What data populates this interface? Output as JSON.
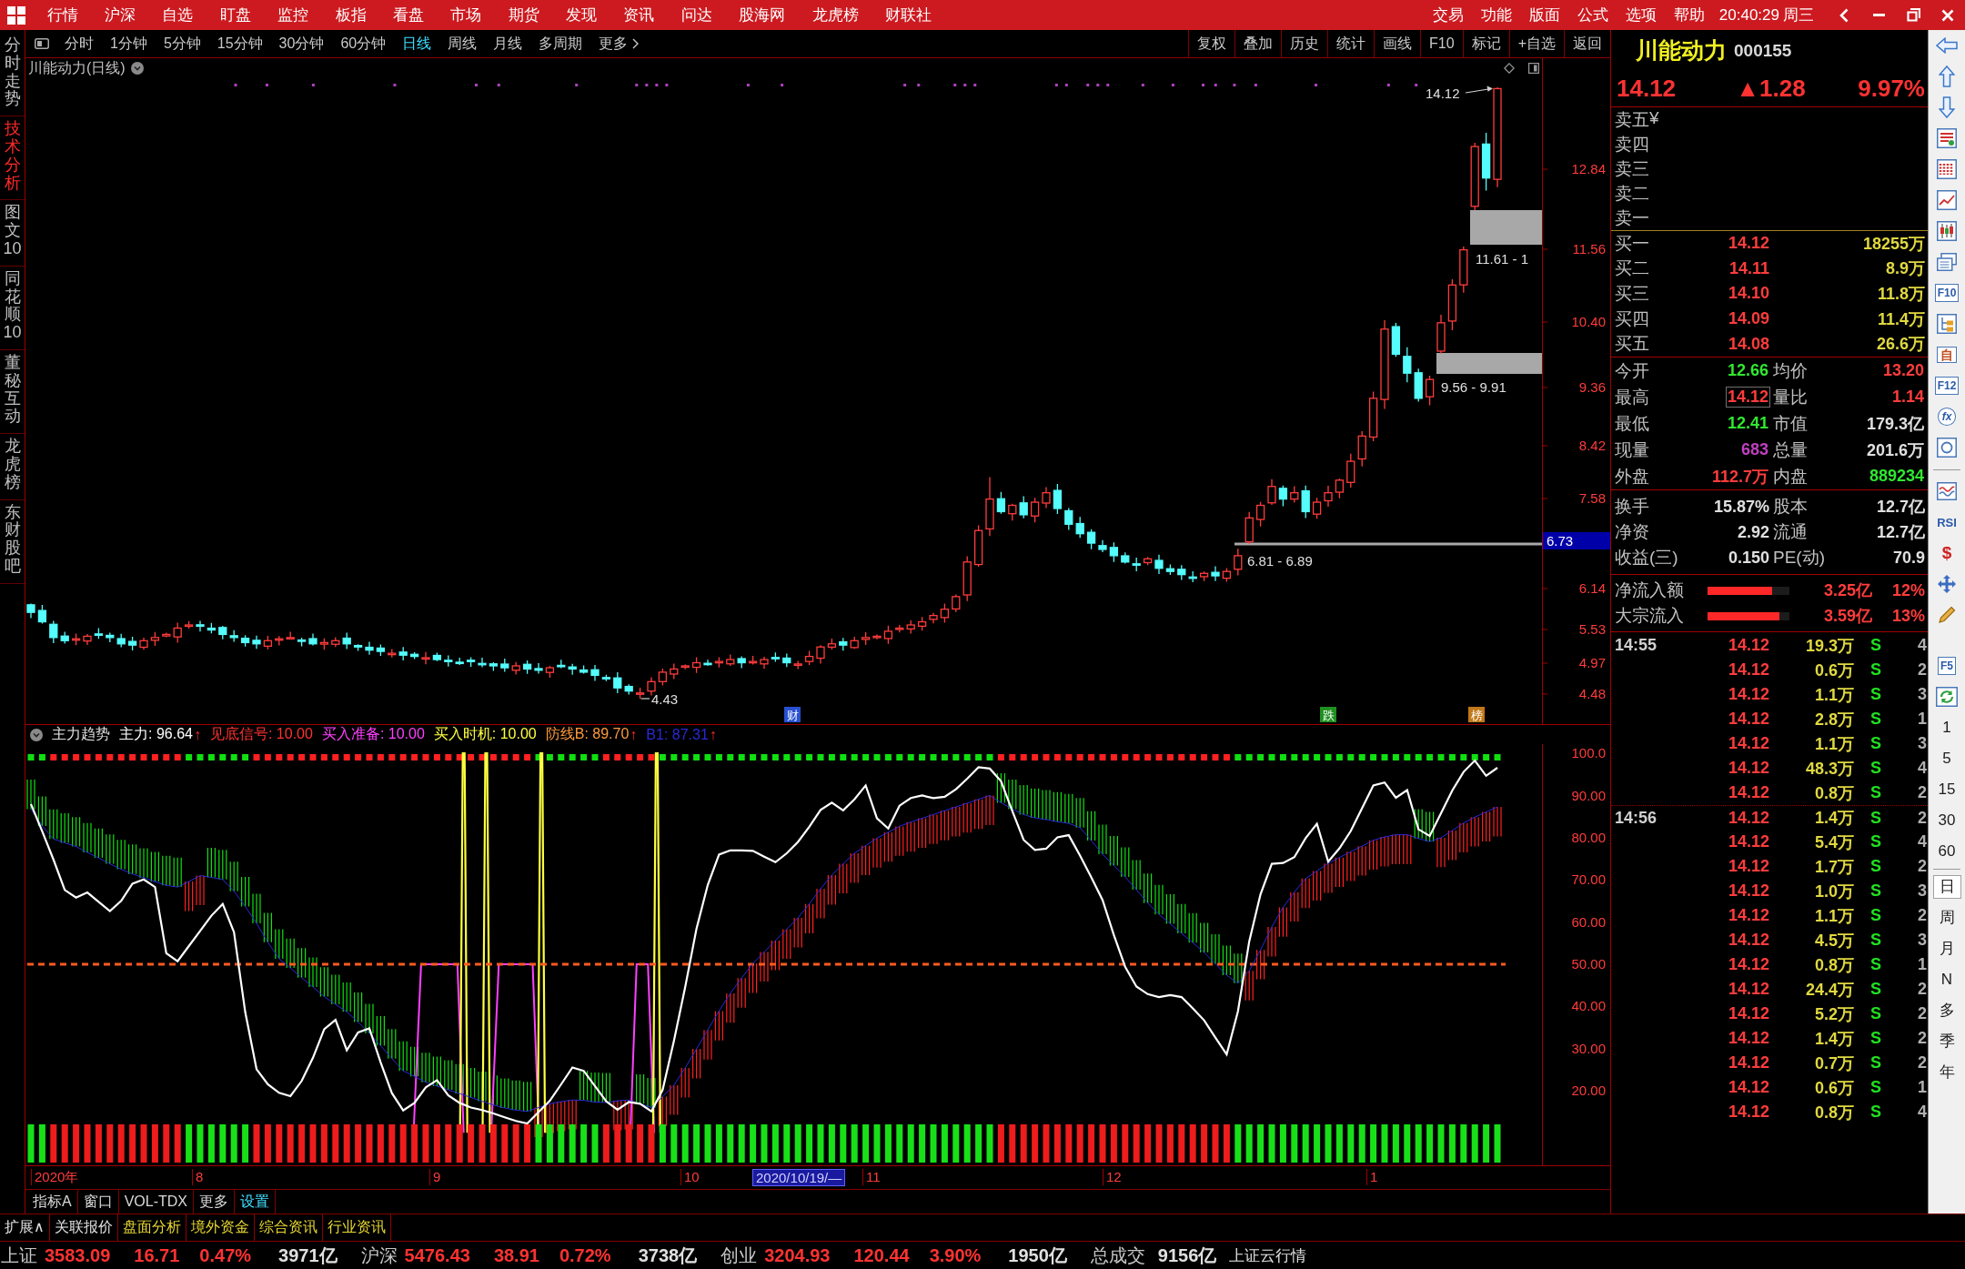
{
  "menu_bar": {
    "items": [
      "行情",
      "沪深",
      "自选",
      "盯盘",
      "监控",
      "板指",
      "看盘",
      "市场",
      "期货",
      "发现",
      "资讯",
      "问达",
      "股海网",
      "龙虎榜",
      "财联社"
    ],
    "right_items": [
      "交易",
      "功能",
      "版面",
      "公式",
      "选项",
      "帮助"
    ],
    "time": "20:40:29",
    "weekday": "周三"
  },
  "side_tabs": [
    {
      "label": "分时走势",
      "selected": false
    },
    {
      "label": "技术分析",
      "selected": true
    },
    {
      "label": "图文10",
      "selected": false
    },
    {
      "label": "同花顺10",
      "selected": false
    },
    {
      "label": "董秘互动",
      "selected": false
    },
    {
      "label": "龙虎榜",
      "selected": false
    },
    {
      "label": "东财股吧",
      "selected": false
    }
  ],
  "toolbar": {
    "periods": [
      {
        "label": "分时",
        "selected": false
      },
      {
        "label": "1分钟",
        "selected": false
      },
      {
        "label": "5分钟",
        "selected": false
      },
      {
        "label": "15分钟",
        "selected": false
      },
      {
        "label": "30分钟",
        "selected": false
      },
      {
        "label": "60分钟",
        "selected": false
      },
      {
        "label": "日线",
        "selected": true
      },
      {
        "label": "周线",
        "selected": false
      },
      {
        "label": "月线",
        "selected": false
      },
      {
        "label": "多周期",
        "selected": false
      }
    ],
    "more": "更多",
    "buttons": [
      "复权",
      "叠加",
      "历史",
      "统计",
      "画线",
      "F10",
      "标记",
      "+自选",
      "返回"
    ]
  },
  "price_chart": {
    "title": "川能动力(日线)",
    "axis": [
      "12.84",
      "11.56",
      "10.40",
      "9.36",
      "8.42",
      "7.58",
      "6.14",
      "5.53",
      "4.97",
      "4.48"
    ],
    "current_level": "6.73",
    "high_label": "14.12",
    "low_label": "4.43",
    "zones": [
      {
        "kind": "box",
        "label": "11.61 - 1"
      },
      {
        "kind": "box",
        "label": "9.56 - 9.91"
      },
      {
        "kind": "line",
        "label": "6.81 - 6.89"
      }
    ],
    "event_marks": [
      {
        "label": "财",
        "color": "#2850d0"
      },
      {
        "label": "跌",
        "color": "#209020"
      },
      {
        "label": "榜",
        "color": "#c07818"
      }
    ]
  },
  "indicator": {
    "name": "主力趋势",
    "readings": [
      {
        "text": "主力: 96.64",
        "color": "#ffffff",
        "arrow": "↑"
      },
      {
        "text": "见底信号: 10.00",
        "color": "#ff3232"
      },
      {
        "text": "买入准备: 10.00",
        "color": "#ff40ff"
      },
      {
        "text": "买入时机: 10.00",
        "color": "#ffff40"
      },
      {
        "text": "防线B: 89.70",
        "color": "#ff9a3c",
        "arrow": "↑"
      },
      {
        "text": "B1: 87.31",
        "color": "#2a2ad8",
        "arrow": "↑"
      }
    ],
    "chart_data": {
      "type": "line",
      "ylim": [
        2.3,
        102.2
      ],
      "yticks": [
        {
          "value": 100,
          "label": "100.0"
        },
        {
          "value": 90,
          "label": "90.00"
        },
        {
          "value": 80,
          "label": "80.00"
        },
        {
          "value": 70,
          "label": "70.00"
        },
        {
          "value": 60,
          "label": "60.00"
        },
        {
          "value": 50,
          "label": "50.00"
        },
        {
          "value": 40,
          "label": "40.00"
        },
        {
          "value": 30,
          "label": "30.00"
        },
        {
          "value": 20,
          "label": "20.00"
        }
      ],
      "ref_lines": [
        {
          "axis": "y",
          "value": 50,
          "color": "#ff5a20"
        }
      ],
      "series": [
        {
          "color": "#ffffff",
          "values": [
            88.0,
            81.5,
            74.8,
            67.6,
            65.8,
            67.0,
            64.8,
            62.6,
            65.0,
            69.1,
            70.1,
            68.3,
            52.6,
            50.7,
            54.3,
            57.9,
            61.5,
            64.3,
            57.6,
            38.6,
            25.1,
            21.5,
            19.5,
            18.7,
            22.3,
            27.8,
            34.6,
            36.8,
            29.6,
            33.8,
            34.8,
            26.7,
            19.4,
            15.3,
            17.1,
            20.8,
            22.5,
            18.9,
            17.1,
            16.0,
            15.4,
            14.6,
            13.7,
            12.8,
            12.2,
            14.9,
            17.6,
            21.5,
            25.5,
            24.7,
            21.1,
            17.5,
            15.5,
            17.3,
            16.9,
            15.1,
            20.2,
            31.8,
            44.6,
            58.4,
            68.8,
            76.0,
            77.0,
            77.0,
            76.9,
            75.5,
            74.2,
            76.3,
            79.0,
            82.6,
            86.6,
            88.3,
            86.5,
            89.1,
            92.4,
            84.6,
            82.2,
            87.6,
            89.4,
            90.0,
            89.4,
            89.7,
            91.5,
            94.0,
            96.7,
            96.4,
            93.4,
            86.3,
            79.5,
            77.1,
            77.4,
            80.1,
            80.6,
            75.8,
            70.6,
            65.2,
            56.9,
            49.4,
            44.7,
            42.9,
            42.2,
            42.7,
            42.2,
            39.5,
            36.7,
            32.6,
            28.6,
            38.8,
            55.4,
            66.6,
            73.8,
            74.0,
            75.4,
            79.9,
            83.3,
            74.3,
            77.5,
            81.6,
            87.0,
            92.4,
            93.1,
            89.5,
            91.3,
            82.0,
            80.4,
            85.8,
            91.2,
            95.6,
            98.3,
            94.7,
            96.6
          ]
        },
        {
          "color": "#2a2ad8",
          "values": [
            86.8,
            82.8,
            79.7,
            78.8,
            77.9,
            76.5,
            75.2,
            73.8,
            72.5,
            71.4,
            70.5,
            69.6,
            68.7,
            68.3,
            69.6,
            71.0,
            70.6,
            70.1,
            67.3,
            63.7,
            59.7,
            55.2,
            51.3,
            49.1,
            46.8,
            44.6,
            42.3,
            40.5,
            38.7,
            36.3,
            33.6,
            30.7,
            27.6,
            24.7,
            23.4,
            22.0,
            21.1,
            20.2,
            19.3,
            18.4,
            17.5,
            16.6,
            15.9,
            15.4,
            15.1,
            16.0,
            16.9,
            17.4,
            17.8,
            17.7,
            17.3,
            17.2,
            17.6,
            17.8,
            16.9,
            16.0,
            18.6,
            21.3,
            25.4,
            29.9,
            34.4,
            38.9,
            43.1,
            46.7,
            50.2,
            52.9,
            55.6,
            58.3,
            61.0,
            64.3,
            67.9,
            71.1,
            73.8,
            76.3,
            78.1,
            79.9,
            81.3,
            82.7,
            83.7,
            84.6,
            85.5,
            86.4,
            87.3,
            88.2,
            89.1,
            90.0,
            88.3,
            86.8,
            85.5,
            84.7,
            84.3,
            83.8,
            83.4,
            82.4,
            79.3,
            76.1,
            73.4,
            70.7,
            67.7,
            64.5,
            61.8,
            59.6,
            57.3,
            55.1,
            52.8,
            50.1,
            47.4,
            45.5,
            48.4,
            53.4,
            58.8,
            63.5,
            67.1,
            70.3,
            72.1,
            73.9,
            75.3,
            76.7,
            78.0,
            79.4,
            80.2,
            80.7,
            80.7,
            79.8,
            79.1,
            80.0,
            81.7,
            83.5,
            84.9,
            86.1,
            87.3
          ]
        }
      ]
    }
  },
  "date_axis": {
    "labels": [
      "2020年",
      "8",
      "9",
      "10",
      "11",
      "12",
      "1"
    ],
    "cursor": "2020/10/19/—"
  },
  "indicator_tabs": [
    {
      "label": "指标A",
      "kind": "tab"
    },
    {
      "label": "窗口",
      "kind": "tab"
    },
    {
      "label": "VOL-TDX",
      "kind": "tab"
    },
    {
      "label": "更多",
      "kind": "tab"
    },
    {
      "label": "设置",
      "kind": "setting"
    }
  ],
  "extension_tabs": [
    {
      "label": "扩展∧",
      "kind": "toggle"
    },
    {
      "label": "关联报价",
      "kind": "page"
    },
    {
      "label": "盘面分析",
      "kind": "info"
    },
    {
      "label": "境外资金",
      "kind": "info"
    },
    {
      "label": "综合资讯",
      "kind": "info"
    },
    {
      "label": "行业资讯",
      "kind": "info"
    }
  ],
  "status_bar": {
    "indices": [
      {
        "name": "上证",
        "price": "3583.09",
        "change": "16.71",
        "percent": "0.47%",
        "amount": "3971亿"
      },
      {
        "name": "沪深",
        "price": "5476.43",
        "change": "38.91",
        "percent": "0.72%",
        "amount": "3738亿"
      },
      {
        "name": "创业",
        "price": "3204.93",
        "change": "120.44",
        "percent": "3.90%",
        "amount": "1950亿"
      }
    ],
    "total_label": "总成交",
    "total": "9156亿",
    "ticker": "上证云行情"
  },
  "quote": {
    "name": "川能动力",
    "code": "000155",
    "price": "14.12",
    "change": "▲1.28",
    "percent": "9.97%",
    "asks": [
      {
        "label": "卖五",
        "mark": "¥"
      },
      {
        "label": "卖四"
      },
      {
        "label": "卖三"
      },
      {
        "label": "卖二"
      },
      {
        "label": "卖一"
      }
    ],
    "bids": [
      {
        "label": "买一",
        "price": "14.12",
        "volume": "18255万"
      },
      {
        "label": "买二",
        "price": "14.11",
        "volume": "8.9万"
      },
      {
        "label": "买三",
        "price": "14.10",
        "volume": "11.8万"
      },
      {
        "label": "买四",
        "price": "14.09",
        "volume": "11.4万"
      },
      {
        "label": "买五",
        "price": "14.08",
        "volume": "26.6万"
      }
    ],
    "stats": [
      {
        "label": "今开",
        "value": "12.66",
        "color": "#30e830",
        "boxed": false
      },
      {
        "label": "均价",
        "value": "13.20",
        "color": "#ff3c3c",
        "boxed": false
      },
      {
        "label": "最高",
        "value": "14.12",
        "color": "#ff3c3c",
        "boxed": true
      },
      {
        "label": "量比",
        "value": "1.14",
        "color": "#ff3c3c",
        "boxed": false
      },
      {
        "label": "最低",
        "value": "12.41",
        "color": "#30e830",
        "boxed": false
      },
      {
        "label": "市值",
        "value": "179.3亿",
        "color": "#e0e0e0",
        "boxed": false
      },
      {
        "label": "现量",
        "value": "683",
        "color": "#c040c0",
        "boxed": false
      },
      {
        "label": "总量",
        "value": "201.6万",
        "color": "#e0e0e0",
        "boxed": false
      },
      {
        "label": "外盘",
        "value": "112.7万",
        "color": "#ff3c3c",
        "boxed": false
      },
      {
        "label": "内盘",
        "value": "889234",
        "color": "#30e830",
        "boxed": false
      }
    ],
    "fundamentals": [
      {
        "label": "换手",
        "value": "15.87%"
      },
      {
        "label": "股本",
        "value": "12.7亿"
      },
      {
        "label": "净资",
        "value": "2.92"
      },
      {
        "label": "流通",
        "value": "12.7亿"
      },
      {
        "label": "收益(三)",
        "value": "0.150"
      },
      {
        "label": "PE(动)",
        "value": "70.9"
      }
    ],
    "flows": [
      {
        "label": "净流入额",
        "level": 0.79,
        "amount": "3.25亿",
        "percent": "12%"
      },
      {
        "label": "大宗流入",
        "level": 0.88,
        "amount": "3.59亿",
        "percent": "13%"
      }
    ]
  },
  "trades": [
    {
      "time": "14:55",
      "price": "14.12",
      "volume": "19.3万",
      "side": "S",
      "count": "4"
    },
    {
      "price": "14.12",
      "volume": "0.6万",
      "side": "S",
      "count": "2"
    },
    {
      "price": "14.12",
      "volume": "1.1万",
      "side": "S",
      "count": "3"
    },
    {
      "price": "14.12",
      "volume": "2.8万",
      "side": "S",
      "count": "1"
    },
    {
      "price": "14.12",
      "volume": "1.1万",
      "side": "S",
      "count": "3"
    },
    {
      "price": "14.12",
      "volume": "48.3万",
      "side": "S",
      "count": "4"
    },
    {
      "price": "14.12",
      "volume": "0.8万",
      "side": "S",
      "count": "2"
    },
    {
      "time": "14:56",
      "price": "14.12",
      "volume": "1.4万",
      "side": "S",
      "count": "2"
    },
    {
      "price": "14.12",
      "volume": "5.4万",
      "side": "S",
      "count": "4"
    },
    {
      "price": "14.12",
      "volume": "1.7万",
      "side": "S",
      "count": "2"
    },
    {
      "price": "14.12",
      "volume": "1.0万",
      "side": "S",
      "count": "3"
    },
    {
      "price": "14.12",
      "volume": "1.1万",
      "side": "S",
      "count": "2"
    },
    {
      "price": "14.12",
      "volume": "4.5万",
      "side": "S",
      "count": "3"
    },
    {
      "price": "14.12",
      "volume": "0.8万",
      "side": "S",
      "count": "1"
    },
    {
      "price": "14.12",
      "volume": "24.4万",
      "side": "S",
      "count": "2"
    },
    {
      "price": "14.12",
      "volume": "5.2万",
      "side": "S",
      "count": "2"
    },
    {
      "price": "14.12",
      "volume": "1.4万",
      "side": "S",
      "count": "2"
    },
    {
      "price": "14.12",
      "volume": "0.7万",
      "side": "S",
      "count": "2"
    },
    {
      "price": "14.12",
      "volume": "0.6万",
      "side": "S",
      "count": "1"
    },
    {
      "price": "14.12",
      "volume": "0.8万",
      "side": "S",
      "count": "4"
    }
  ],
  "side_bar": {
    "tool_texts": [
      "F10",
      "自",
      "F12",
      "fx",
      "RSI",
      "$",
      "F5"
    ],
    "minute_periods": [
      {
        "label": "1",
        "selected": false
      },
      {
        "label": "5",
        "selected": false
      },
      {
        "label": "15",
        "selected": false
      },
      {
        "label": "30",
        "selected": false
      },
      {
        "label": "60",
        "selected": false
      }
    ],
    "periods": [
      {
        "label": "日",
        "selected": true
      },
      {
        "label": "周",
        "selected": false
      },
      {
        "label": "月",
        "selected": false
      },
      {
        "label": "N",
        "selected": false
      },
      {
        "label": "多",
        "selected": false
      },
      {
        "label": "季",
        "selected": false
      },
      {
        "label": "年",
        "selected": false
      }
    ]
  }
}
